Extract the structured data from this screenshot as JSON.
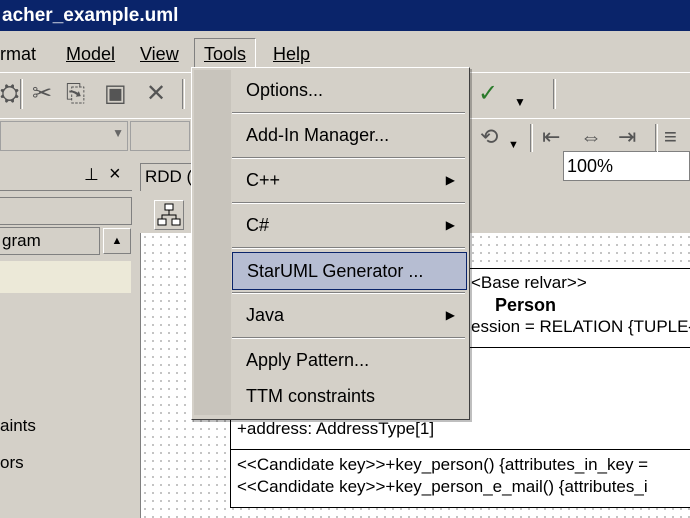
{
  "window": {
    "title": "acher_example.uml"
  },
  "menubar": {
    "items": [
      {
        "label": "rmat"
      },
      {
        "label": "Model"
      },
      {
        "label": "View"
      },
      {
        "label": "Tools"
      },
      {
        "label": "Help"
      }
    ]
  },
  "toolbar": {
    "zoom_value": "100%"
  },
  "left_panel": {
    "pin_glyph": "⊥",
    "close_glyph": "×",
    "tab_label": "gram",
    "text_1": "aints",
    "text_2": "ors"
  },
  "doc_tab": {
    "label": "RDD ("
  },
  "tools_menu": {
    "items": [
      {
        "label": "Options..."
      },
      {
        "label": "Add-In Manager..."
      },
      {
        "label": "C++"
      },
      {
        "label": "C#"
      },
      {
        "label": "StarUML Generator ..."
      },
      {
        "label": "Java"
      },
      {
        "label": "Apply Pattern..."
      },
      {
        "label": "TTM constraints"
      }
    ]
  },
  "diagram": {
    "stereotype": "<Base relvar>>",
    "class_name": "Person",
    "expression": "ession = RELATION {TUPLE{",
    "attribute": "+address: AddressType[1]",
    "operation_1": "<<Candidate key>>+key_person() {attributes_in_key =",
    "operation_2": "<<Candidate key>>+key_person_e_mail() {attributes_i"
  },
  "colors": {
    "titlebar": "#0a246a",
    "highlight": "#b6bdd2",
    "chrome": "#d4d0c8"
  }
}
